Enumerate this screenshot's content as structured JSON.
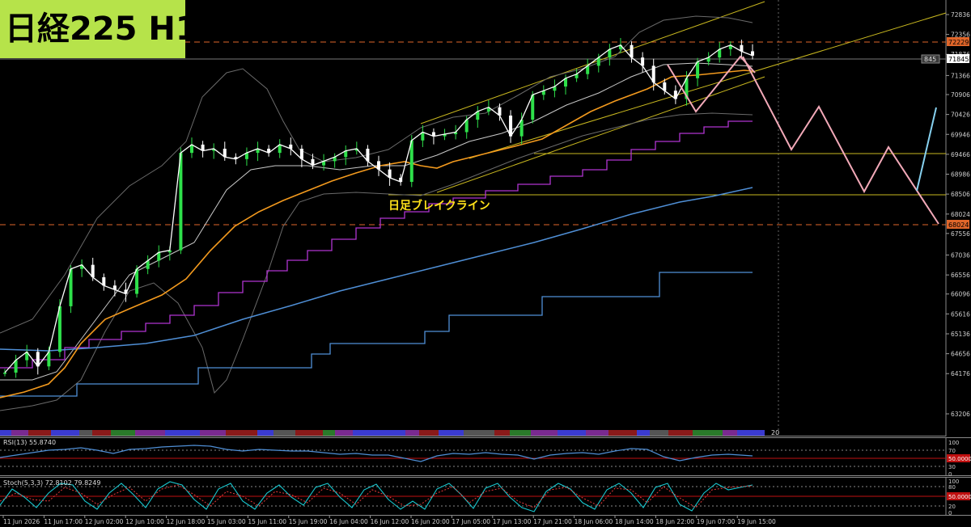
{
  "header": {
    "title": "日経225 H1"
  },
  "annotation": {
    "breakline_label": "日足ブレイクライン"
  },
  "panels": {
    "rsi_label": "RSI(13) 55.8740",
    "stoch_label": "Stoch(5,3,3) 72.8102 79.8249",
    "strip_value": "20"
  },
  "chart_data": {
    "type": "candlestick",
    "symbol": "日経225",
    "timeframe": "H1",
    "x_ticks": [
      "11 Jun 2026",
      "11 Jun 17:00",
      "12 Jun 02:00",
      "12 Jun 10:00",
      "12 Jun 18:00",
      "15 Jun 03:00",
      "15 Jun 11:00",
      "15 Jun 19:00",
      "16 Jun 04:00",
      "16 Jun 12:00",
      "16 Jun 20:00",
      "17 Jun 05:00",
      "17 Jun 13:00",
      "17 Jun 21:00",
      "18 Jun 06:00",
      "18 Jun 14:00",
      "18 Jun 22:00",
      "19 Jun 07:00",
      "19 Jun 15:00"
    ],
    "y_ticks": [
      72836,
      72356,
      71876,
      71366,
      70906,
      70426,
      69946,
      69466,
      68986,
      68506,
      68024,
      67556,
      67036,
      66556,
      66096,
      65616,
      65136,
      64656,
      64176,
      63206
    ],
    "ylim": [
      63206,
      72836
    ],
    "price_labels": {
      "resistance": "72229",
      "current": "71845",
      "support": "68024",
      "spread": "845"
    },
    "close_path": [
      64200,
      64500,
      64700,
      64350,
      64700,
      65800,
      66700,
      66800,
      66500,
      66300,
      66200,
      66100,
      66700,
      66900,
      67100,
      67150,
      69500,
      69700,
      69550,
      69600,
      69400,
      69350,
      69500,
      69600,
      69500,
      69700,
      69600,
      69350,
      69200,
      69300,
      69400,
      69550,
      69600,
      69300,
      69100,
      68900,
      68800,
      69800,
      70000,
      69900,
      69950,
      70000,
      70300,
      70500,
      70600,
      70400,
      69900,
      70300,
      70900,
      71000,
      71100,
      71300,
      71400,
      71600,
      71800,
      72000,
      72100,
      71800,
      71600,
      71200,
      71000,
      70800,
      71300,
      71700,
      71800,
      72000,
      72100,
      71950,
      71845
    ],
    "lines": {
      "horizontal_support": 69466,
      "breakline": 68700
    },
    "forecast_zigzag": [
      71800,
      70000,
      70800,
      69600,
      70100,
      68900,
      69500
    ],
    "forecast_bounce": [
      69000,
      70700
    ],
    "oscillators": {
      "rsi": {
        "period": 13,
        "value": 55.874,
        "levels": [
          30,
          50,
          70
        ]
      },
      "stoch": {
        "params": "5,3,3",
        "k": 72.8102,
        "d": 79.8249,
        "levels": [
          20,
          50,
          80
        ]
      }
    }
  }
}
